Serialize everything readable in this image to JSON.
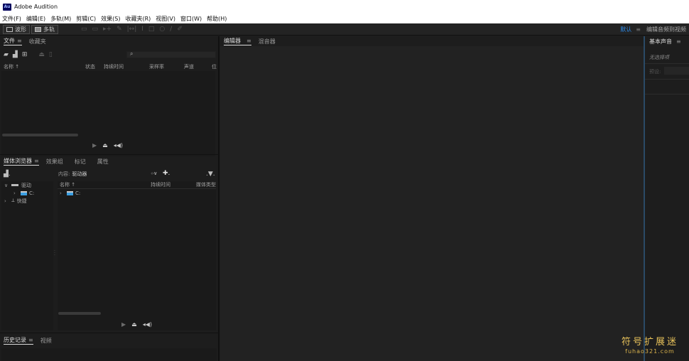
{
  "window": {
    "app_icon": "Au",
    "title": "Adobe Audition"
  },
  "menu": [
    "文件(F)",
    "编辑(E)",
    "多轨(M)",
    "剪辑(C)",
    "效果(S)",
    "收藏夹(R)",
    "视图(V)",
    "窗口(W)",
    "帮助(H)"
  ],
  "toolbar": {
    "waveform_label": "波形",
    "multitrack_label": "多轨",
    "workspace_default": "默认",
    "workspace_menu": "≡",
    "workspace_other": "编辑音频到视频"
  },
  "files_panel": {
    "tabs": [
      "文件",
      "收藏夹"
    ],
    "columns": [
      "名称 ↑",
      "状态",
      "持续时间",
      "采样率",
      "声道",
      "位"
    ]
  },
  "media_panel": {
    "tabs": [
      "媒体浏览器",
      "效果组",
      "标记",
      "属性"
    ],
    "content_label": "内容:",
    "content_value": "驱动器",
    "columns": [
      "名称 ↑",
      "持续时间",
      "媒体类型"
    ],
    "tree": [
      {
        "chev": "∨",
        "label": "驱动"
      },
      {
        "chev": "›",
        "label": "C:"
      },
      {
        "chev": "›",
        "label": "快捷"
      }
    ],
    "list": [
      {
        "chev": "›",
        "label": "C:"
      }
    ]
  },
  "history_panel": {
    "tabs": [
      "历史记录",
      "视频"
    ]
  },
  "editor_panel": {
    "tabs": [
      "编辑器",
      "混音器"
    ]
  },
  "essential_sound": {
    "tab": "基本声音",
    "no_selection": "无选择项",
    "preset_label": "预设:"
  },
  "watermark": {
    "cn": "符号扩展迷",
    "en": "fuhao321.com"
  }
}
